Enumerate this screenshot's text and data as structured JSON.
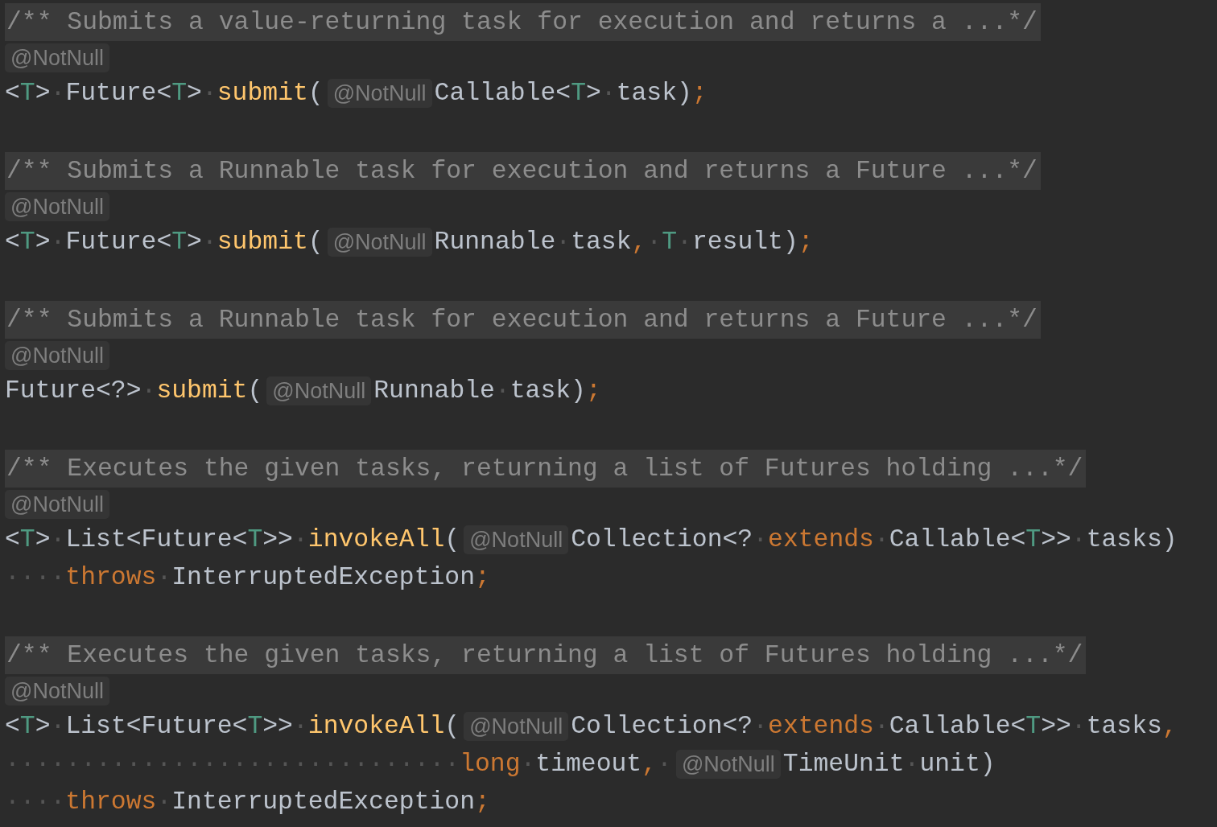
{
  "editor": {
    "lines": [
      {
        "kind": "comment",
        "text": "/** Submits a value-returning task for execution and returns a ...*/"
      },
      {
        "kind": "hint",
        "text": "@NotNull"
      },
      {
        "kind": "code",
        "segments": [
          {
            "kind": "code",
            "tokens": [
              {
                "text": "<",
                "kind": "p"
              },
              {
                "text": "T",
                "kind": "tp"
              },
              {
                "text": ">",
                "kind": "p"
              },
              {
                "text": "·",
                "kind": "ws"
              },
              {
                "text": "Future<",
                "kind": "p"
              },
              {
                "text": "T",
                "kind": "tp"
              },
              {
                "text": ">",
                "kind": "p"
              },
              {
                "text": "·",
                "kind": "ws"
              },
              {
                "text": "submit",
                "kind": "fn"
              },
              {
                "text": "(",
                "kind": "p"
              }
            ]
          },
          {
            "kind": "hint",
            "text": "@NotNull"
          },
          {
            "kind": "code",
            "tokens": [
              {
                "text": "Callable<",
                "kind": "p"
              },
              {
                "text": "T",
                "kind": "tp"
              },
              {
                "text": ">",
                "kind": "p"
              },
              {
                "text": "·",
                "kind": "ws"
              },
              {
                "text": "task)",
                "kind": "p"
              },
              {
                "text": ";",
                "kind": "kw"
              }
            ]
          }
        ]
      },
      {
        "kind": "blank"
      },
      {
        "kind": "comment",
        "text": "/** Submits a Runnable task for execution and returns a Future ...*/"
      },
      {
        "kind": "hint",
        "text": "@NotNull"
      },
      {
        "kind": "code",
        "segments": [
          {
            "kind": "code",
            "tokens": [
              {
                "text": "<",
                "kind": "p"
              },
              {
                "text": "T",
                "kind": "tp"
              },
              {
                "text": ">",
                "kind": "p"
              },
              {
                "text": "·",
                "kind": "ws"
              },
              {
                "text": "Future<",
                "kind": "p"
              },
              {
                "text": "T",
                "kind": "tp"
              },
              {
                "text": ">",
                "kind": "p"
              },
              {
                "text": "·",
                "kind": "ws"
              },
              {
                "text": "submit",
                "kind": "fn"
              },
              {
                "text": "(",
                "kind": "p"
              }
            ]
          },
          {
            "kind": "hint",
            "text": "@NotNull"
          },
          {
            "kind": "code",
            "tokens": [
              {
                "text": "Runnable",
                "kind": "p"
              },
              {
                "text": "·",
                "kind": "ws"
              },
              {
                "text": "task",
                "kind": "p"
              },
              {
                "text": ",",
                "kind": "kw"
              },
              {
                "text": "·",
                "kind": "ws"
              },
              {
                "text": "T",
                "kind": "tp"
              },
              {
                "text": "·",
                "kind": "ws"
              },
              {
                "text": "result)",
                "kind": "p"
              },
              {
                "text": ";",
                "kind": "kw"
              }
            ]
          }
        ]
      },
      {
        "kind": "blank"
      },
      {
        "kind": "comment",
        "text": "/** Submits a Runnable task for execution and returns a Future ...*/"
      },
      {
        "kind": "hint",
        "text": "@NotNull"
      },
      {
        "kind": "code",
        "segments": [
          {
            "kind": "code",
            "tokens": [
              {
                "text": "Future<?>",
                "kind": "p"
              },
              {
                "text": "·",
                "kind": "ws"
              },
              {
                "text": "submit",
                "kind": "fn"
              },
              {
                "text": "(",
                "kind": "p"
              }
            ]
          },
          {
            "kind": "hint",
            "text": "@NotNull"
          },
          {
            "kind": "code",
            "tokens": [
              {
                "text": "Runnable",
                "kind": "p"
              },
              {
                "text": "·",
                "kind": "ws"
              },
              {
                "text": "task)",
                "kind": "p"
              },
              {
                "text": ";",
                "kind": "kw"
              }
            ]
          }
        ]
      },
      {
        "kind": "blank"
      },
      {
        "kind": "comment",
        "text": "/** Executes the given tasks, returning a list of Futures holding ...*/"
      },
      {
        "kind": "hint",
        "text": "@NotNull"
      },
      {
        "kind": "code",
        "segments": [
          {
            "kind": "code",
            "tokens": [
              {
                "text": "<",
                "kind": "p"
              },
              {
                "text": "T",
                "kind": "tp"
              },
              {
                "text": ">",
                "kind": "p"
              },
              {
                "text": "·",
                "kind": "ws"
              },
              {
                "text": "List<Future<",
                "kind": "p"
              },
              {
                "text": "T",
                "kind": "tp"
              },
              {
                "text": ">>",
                "kind": "p"
              },
              {
                "text": "·",
                "kind": "ws"
              },
              {
                "text": "invokeAll",
                "kind": "fn"
              },
              {
                "text": "(",
                "kind": "p"
              }
            ]
          },
          {
            "kind": "hint",
            "text": "@NotNull"
          },
          {
            "kind": "code",
            "tokens": [
              {
                "text": "Collection<?",
                "kind": "p"
              },
              {
                "text": "·",
                "kind": "ws"
              },
              {
                "text": "extends",
                "kind": "kw"
              },
              {
                "text": "·",
                "kind": "ws"
              },
              {
                "text": "Callable<",
                "kind": "p"
              },
              {
                "text": "T",
                "kind": "tp"
              },
              {
                "text": ">>",
                "kind": "p"
              },
              {
                "text": "·",
                "kind": "ws"
              },
              {
                "text": "tasks)",
                "kind": "p"
              }
            ]
          }
        ]
      },
      {
        "kind": "code",
        "segments": [
          {
            "kind": "code",
            "tokens": [
              {
                "text": "····",
                "kind": "ws"
              },
              {
                "text": "throws",
                "kind": "kw"
              },
              {
                "text": "·",
                "kind": "ws"
              },
              {
                "text": "InterruptedException",
                "kind": "p"
              },
              {
                "text": ";",
                "kind": "kw"
              }
            ]
          }
        ]
      },
      {
        "kind": "blank"
      },
      {
        "kind": "comment",
        "text": "/** Executes the given tasks, returning a list of Futures holding ...*/"
      },
      {
        "kind": "hint",
        "text": "@NotNull"
      },
      {
        "kind": "code",
        "segments": [
          {
            "kind": "code",
            "tokens": [
              {
                "text": "<",
                "kind": "p"
              },
              {
                "text": "T",
                "kind": "tp"
              },
              {
                "text": ">",
                "kind": "p"
              },
              {
                "text": "·",
                "kind": "ws"
              },
              {
                "text": "List<Future<",
                "kind": "p"
              },
              {
                "text": "T",
                "kind": "tp"
              },
              {
                "text": ">>",
                "kind": "p"
              },
              {
                "text": "·",
                "kind": "ws"
              },
              {
                "text": "invokeAll",
                "kind": "fn"
              },
              {
                "text": "(",
                "kind": "p"
              }
            ]
          },
          {
            "kind": "hint",
            "text": "@NotNull"
          },
          {
            "kind": "code",
            "tokens": [
              {
                "text": "Collection<?",
                "kind": "p"
              },
              {
                "text": "·",
                "kind": "ws"
              },
              {
                "text": "extends",
                "kind": "kw"
              },
              {
                "text": "·",
                "kind": "ws"
              },
              {
                "text": "Callable<",
                "kind": "p"
              },
              {
                "text": "T",
                "kind": "tp"
              },
              {
                "text": ">>",
                "kind": "p"
              },
              {
                "text": "·",
                "kind": "ws"
              },
              {
                "text": "tasks",
                "kind": "p"
              },
              {
                "text": ",",
                "kind": "kw"
              }
            ]
          }
        ]
      },
      {
        "kind": "code",
        "segments": [
          {
            "kind": "code",
            "tokens": [
              {
                "text": "······························",
                "kind": "ws"
              },
              {
                "text": "long",
                "kind": "kw"
              },
              {
                "text": "·",
                "kind": "ws"
              },
              {
                "text": "timeout",
                "kind": "p"
              },
              {
                "text": ",",
                "kind": "kw"
              },
              {
                "text": "·",
                "kind": "ws"
              }
            ]
          },
          {
            "kind": "hint",
            "text": "@NotNull"
          },
          {
            "kind": "code",
            "tokens": [
              {
                "text": "TimeUnit",
                "kind": "p"
              },
              {
                "text": "·",
                "kind": "ws"
              },
              {
                "text": "unit)",
                "kind": "p"
              }
            ]
          }
        ]
      },
      {
        "kind": "code",
        "segments": [
          {
            "kind": "code",
            "tokens": [
              {
                "text": "····",
                "kind": "ws"
              },
              {
                "text": "throws",
                "kind": "kw"
              },
              {
                "text": "·",
                "kind": "ws"
              },
              {
                "text": "InterruptedException",
                "kind": "p"
              },
              {
                "text": ";",
                "kind": "kw"
              }
            ]
          }
        ]
      }
    ]
  }
}
